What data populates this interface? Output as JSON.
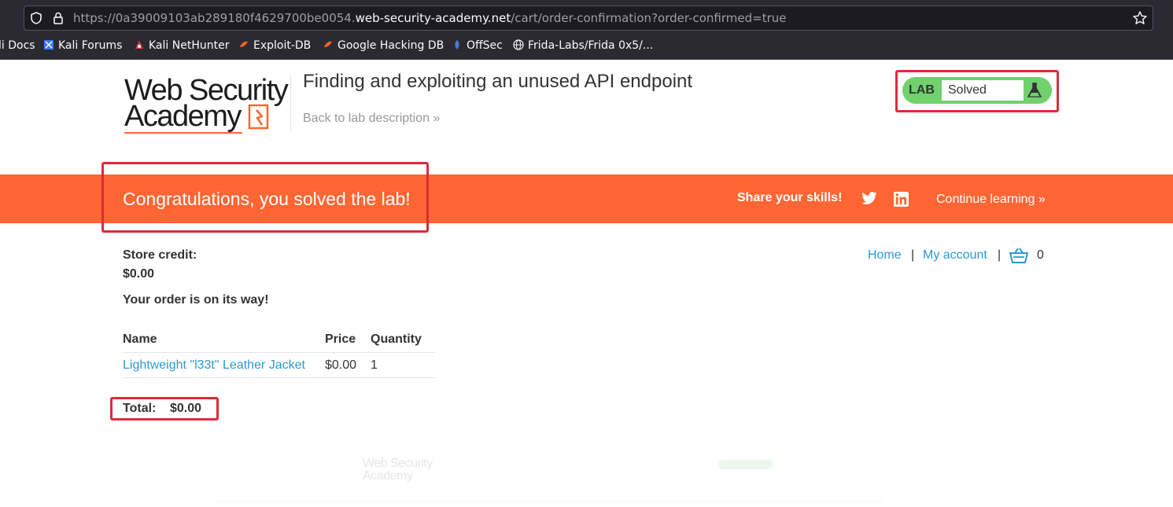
{
  "browser": {
    "url_prefix": "https://0a39009103ab289180f4629700be0054.",
    "url_domain": "web-security-academy.net",
    "url_path": "/cart/order-confirmation?order-confirmed=true"
  },
  "bookmarks": [
    {
      "label": "li Docs",
      "icon": "kali-docs-icon"
    },
    {
      "label": "Kali Forums",
      "icon": "kali-forums-icon"
    },
    {
      "label": "Kali NetHunter",
      "icon": "kali-nethunter-icon"
    },
    {
      "label": "Exploit-DB",
      "icon": "exploit-db-icon"
    },
    {
      "label": "Google Hacking DB",
      "icon": "ghdb-icon"
    },
    {
      "label": "OffSec",
      "icon": "offsec-icon"
    },
    {
      "label": "Frida-Labs/Frida 0x5/...",
      "icon": "globe-icon"
    }
  ],
  "header": {
    "logo_line1": "Web Security",
    "logo_line2": "Academy",
    "lab_title": "Finding and exploiting an unused API endpoint",
    "back_link": "Back to lab description »",
    "lab_badge": "LAB",
    "lab_status": "Solved"
  },
  "banner": {
    "message": "Congratulations, you solved the lab!",
    "share": "Share your skills!",
    "continue": "Continue learning »"
  },
  "nav": {
    "home": "Home",
    "separator": "|",
    "account": "My account",
    "cart_count": "0"
  },
  "store": {
    "credit_label": "Store credit:",
    "credit_value": "$0.00",
    "order_message": "Your order is on its way!"
  },
  "order_table": {
    "headers": [
      "Name",
      "Price",
      "Quantity"
    ],
    "rows": [
      {
        "name": "Lightweight \"l33t\" Leather Jacket",
        "price": "$0.00",
        "quantity": "1"
      }
    ],
    "total_label": "Total:",
    "total_value": "$0.00"
  },
  "colors": {
    "accent_orange": "#ff6633",
    "link_blue": "#2b9ad3",
    "solved_green": "#70d16d",
    "highlight_red": "#dd2b3a"
  }
}
